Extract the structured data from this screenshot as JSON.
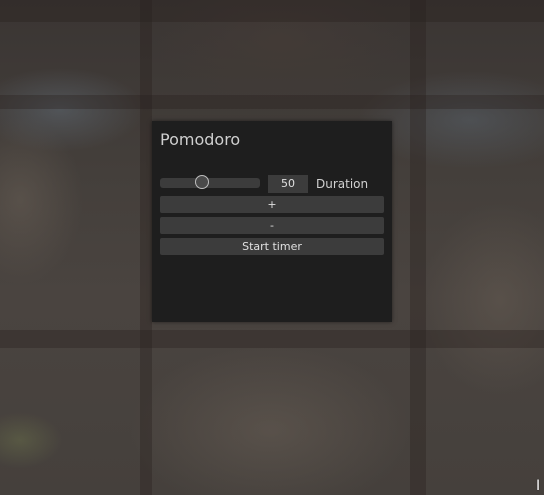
{
  "window": {
    "title": "Pomodoro"
  },
  "duration": {
    "slider_value": 50,
    "slider_min": 0,
    "slider_max": 100,
    "value_text": "50",
    "label": "Duration"
  },
  "buttons": {
    "increment_label": "+",
    "decrement_label": "-",
    "start_label": "Start timer"
  },
  "colors": {
    "window_bg": "#1e1e1e",
    "widget_bg": "#3c3c3c",
    "text": "#e0e0e0"
  },
  "icons": {
    "cursor": "text-cursor-icon"
  }
}
